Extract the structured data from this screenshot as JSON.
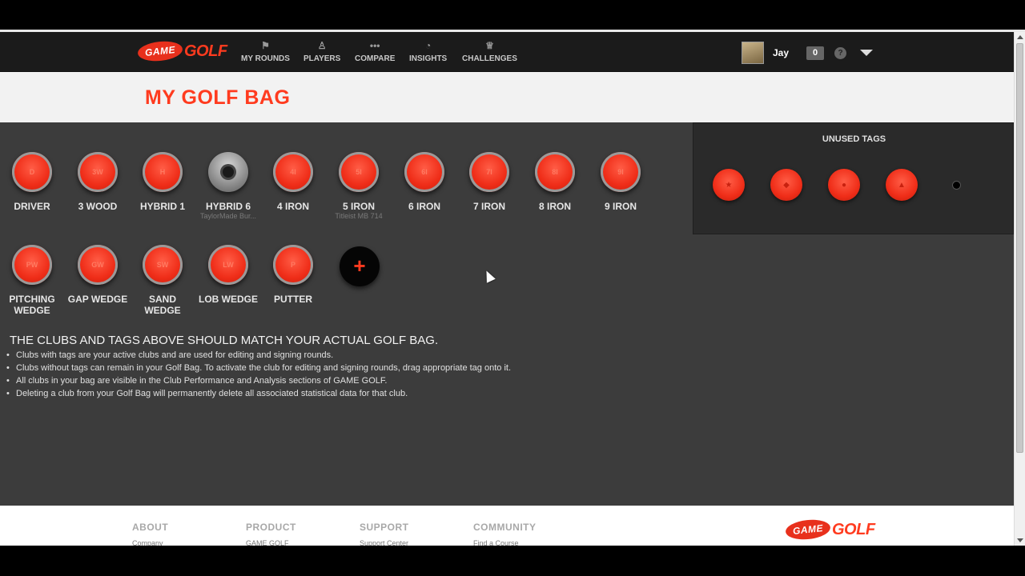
{
  "nav": {
    "items": [
      {
        "label": "MY ROUNDS",
        "icon": "flag-icon"
      },
      {
        "label": "PLAYERS",
        "icon": "person-icon"
      },
      {
        "label": "COMPARE",
        "icon": "dots-icon"
      },
      {
        "label": "INSIGHTS",
        "icon": "pie-icon"
      },
      {
        "label": "CHALLENGES",
        "icon": "trophy-icon"
      }
    ],
    "logo_pill": "GAME",
    "logo_word": "GOLF",
    "user_name": "Jay",
    "message_count": "0",
    "help_glyph": "?"
  },
  "page": {
    "title": "MY GOLF BAG"
  },
  "clubs": [
    {
      "code": "D",
      "name": "DRIVER",
      "sub": ""
    },
    {
      "code": "3W",
      "name": "3 WOOD",
      "sub": ""
    },
    {
      "code": "H",
      "name": "HYBRID 1",
      "sub": ""
    },
    {
      "code": "",
      "name": "HYBRID 6",
      "sub": "TaylorMade Bur..."
    },
    {
      "code": "4I",
      "name": "4 IRON",
      "sub": ""
    },
    {
      "code": "5I",
      "name": "5 IRON",
      "sub": "Titleist MB 714"
    },
    {
      "code": "6I",
      "name": "6 IRON",
      "sub": ""
    },
    {
      "code": "7I",
      "name": "7 IRON",
      "sub": ""
    },
    {
      "code": "8I",
      "name": "8 IRON",
      "sub": ""
    },
    {
      "code": "9I",
      "name": "9 IRON",
      "sub": ""
    },
    {
      "code": "PW",
      "name": "PITCHING WEDGE",
      "sub": ""
    },
    {
      "code": "GW",
      "name": "GAP WEDGE",
      "sub": ""
    },
    {
      "code": "SW",
      "name": "SAND WEDGE",
      "sub": ""
    },
    {
      "code": "LW",
      "name": "LOB WEDGE",
      "sub": ""
    },
    {
      "code": "P",
      "name": "PUTTER",
      "sub": ""
    }
  ],
  "add_club": "+",
  "unused_tags": {
    "title": "UNUSED TAGS",
    "tags": [
      {
        "glyph": "★",
        "icon": "star-tag-icon"
      },
      {
        "glyph": "◆",
        "icon": "diamond-tag-icon"
      },
      {
        "glyph": "●",
        "icon": "circle-tag-icon"
      },
      {
        "glyph": "▲",
        "icon": "triangle-tag-icon"
      }
    ]
  },
  "info": {
    "heading": "THE CLUBS AND TAGS ABOVE SHOULD MATCH YOUR ACTUAL GOLF BAG.",
    "bullets": [
      "Clubs with tags are your active clubs and are used for editing and signing rounds.",
      "Clubs without tags can remain in your Golf Bag. To activate the club for editing and signing rounds, drag appropriate tag onto it.",
      "All clubs in your bag are visible in the Club Performance and Analysis sections of GAME GOLF.",
      "Deleting a club from your Golf Bag will permanently delete all associated statistical data for that club."
    ]
  },
  "footer": {
    "columns": [
      {
        "title": "ABOUT",
        "first_link": "Company"
      },
      {
        "title": "PRODUCT",
        "first_link": "GAME GOLF"
      },
      {
        "title": "SUPPORT",
        "first_link": "Support Center"
      },
      {
        "title": "COMMUNITY",
        "first_link": "Find a Course"
      }
    ],
    "logo_pill": "GAME",
    "logo_word": "GOLF"
  },
  "colors": {
    "accent": "#ff3b1f",
    "nav_bg": "#1b1b1b",
    "content_bg": "#3c3c3c",
    "panel_bg": "#2a2a2a"
  }
}
